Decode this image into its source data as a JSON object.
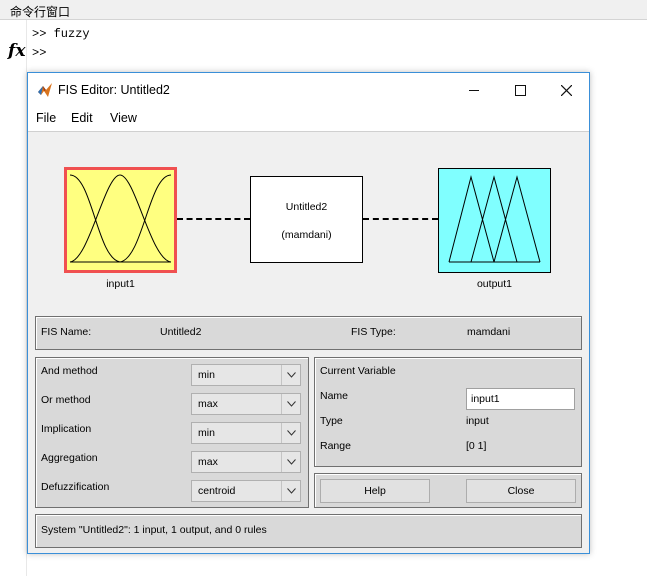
{
  "command_window": {
    "title": "命令行窗口",
    "lines": [
      ">> fuzzy",
      ">>"
    ],
    "fx_symbol": "fx"
  },
  "fis_window": {
    "title": "FIS Editor: Untitled2",
    "menu": [
      "File",
      "Edit",
      "View"
    ],
    "diagram": {
      "input_label": "input1",
      "rule_name": "Untitled2",
      "rule_type": "(mamdani)",
      "output_label": "output1",
      "colors": {
        "input_fill": "#ffff80",
        "input_border": "#f05050",
        "output_fill": "#80ffff"
      }
    },
    "fis_info": {
      "name_label": "FIS Name:",
      "name_value": "Untitled2",
      "type_label": "FIS Type:",
      "type_value": "mamdani"
    },
    "methods": [
      {
        "label": "And method",
        "value": "min"
      },
      {
        "label": "Or method",
        "value": "max"
      },
      {
        "label": "Implication",
        "value": "min"
      },
      {
        "label": "Aggregation",
        "value": "max"
      },
      {
        "label": "Defuzzification",
        "value": "centroid"
      }
    ],
    "current_variable": {
      "header": "Current Variable",
      "name_label": "Name",
      "name_value": "input1",
      "type_label": "Type",
      "type_value": "input",
      "range_label": "Range",
      "range_value": "[0 1]"
    },
    "buttons": {
      "help": "Help",
      "close": "Close"
    },
    "status": "System \"Untitled2\": 1 input, 1 output, and 0 rules"
  }
}
